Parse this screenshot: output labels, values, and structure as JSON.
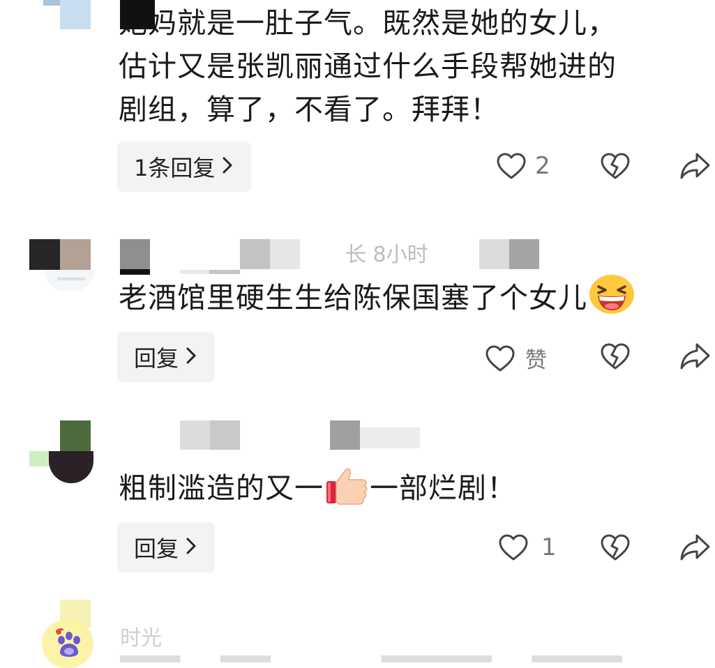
{
  "comments": [
    {
      "lines": [
        "她妈就是一肚子气。既然是她的女儿，",
        "估计又是张凯丽通过什么手段帮她进的",
        "剧组，算了，不看了。拜拜！"
      ],
      "reply_label": "1条回复",
      "like_count": "2"
    },
    {
      "meta_fragment": "长  8小时",
      "text": "老酒馆里硬生生给陈保国塞了个女儿",
      "emoji": "grinning-squinting-face",
      "reply_label": "回复",
      "like_count": "赞"
    },
    {
      "text_before": "粗制滥造的又一",
      "emoji": "thumbs-up",
      "text_after": "一部烂剧！",
      "reply_label": "回复",
      "like_count": "1"
    },
    {
      "meta_fragment": "时光"
    }
  ],
  "icons": {
    "like": "heart-outline-icon",
    "dislike": "broken-heart-icon",
    "share": "share-arrow-icon",
    "chevron": "chevron-right-icon"
  },
  "colors": {
    "text": "#1a1a1a",
    "muted": "#777777",
    "reply_bg": "#f3f3f3"
  }
}
